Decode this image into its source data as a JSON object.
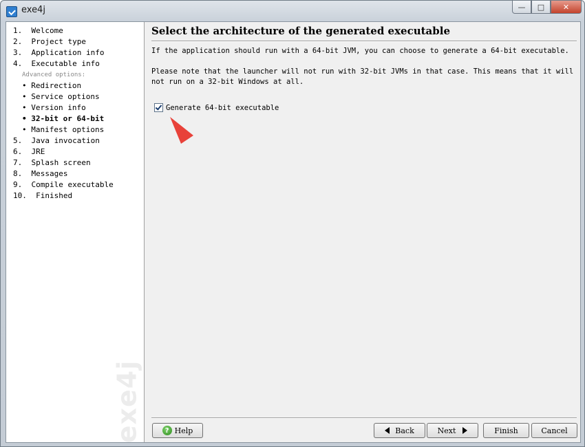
{
  "window": {
    "title": "exe4j"
  },
  "caption_buttons": {
    "minimize": "—",
    "maximize": "□",
    "close": "✕"
  },
  "nav": {
    "items": [
      {
        "label": "1.  Welcome"
      },
      {
        "label": "2.  Project type"
      },
      {
        "label": "3.  Application info"
      },
      {
        "label": "4.  Executable info"
      }
    ],
    "advanced_label": "Advanced options:",
    "sub_items": [
      {
        "label": "• Redirection"
      },
      {
        "label": "• Service options"
      },
      {
        "label": "• Version info"
      },
      {
        "label": "• 32-bit or 64-bit"
      },
      {
        "label": "• Manifest options"
      }
    ],
    "items2": [
      {
        "label": "5.  Java invocation"
      },
      {
        "label": "6.  JRE"
      },
      {
        "label": "7.  Splash screen"
      },
      {
        "label": "8.  Messages"
      },
      {
        "label": "9.  Compile executable"
      },
      {
        "label": "10.  Finished"
      }
    ],
    "watermark": "exe4j"
  },
  "content": {
    "heading": "Select the architecture of the generated executable",
    "para1": "If the application should run with a 64-bit JVM, you can choose to generate a 64-bit executable.",
    "para2": "Please note that the launcher will not run with 32-bit JVMs in that case. This means that it will not run on a 32-bit Windows at all.",
    "checkbox_label": "Generate 64-bit executable",
    "checkbox_checked": true
  },
  "buttons": {
    "help": "Help",
    "back": "Back",
    "next": "Next",
    "finish": "Finish",
    "cancel": "Cancel"
  },
  "annotation_color": "#e8423a"
}
